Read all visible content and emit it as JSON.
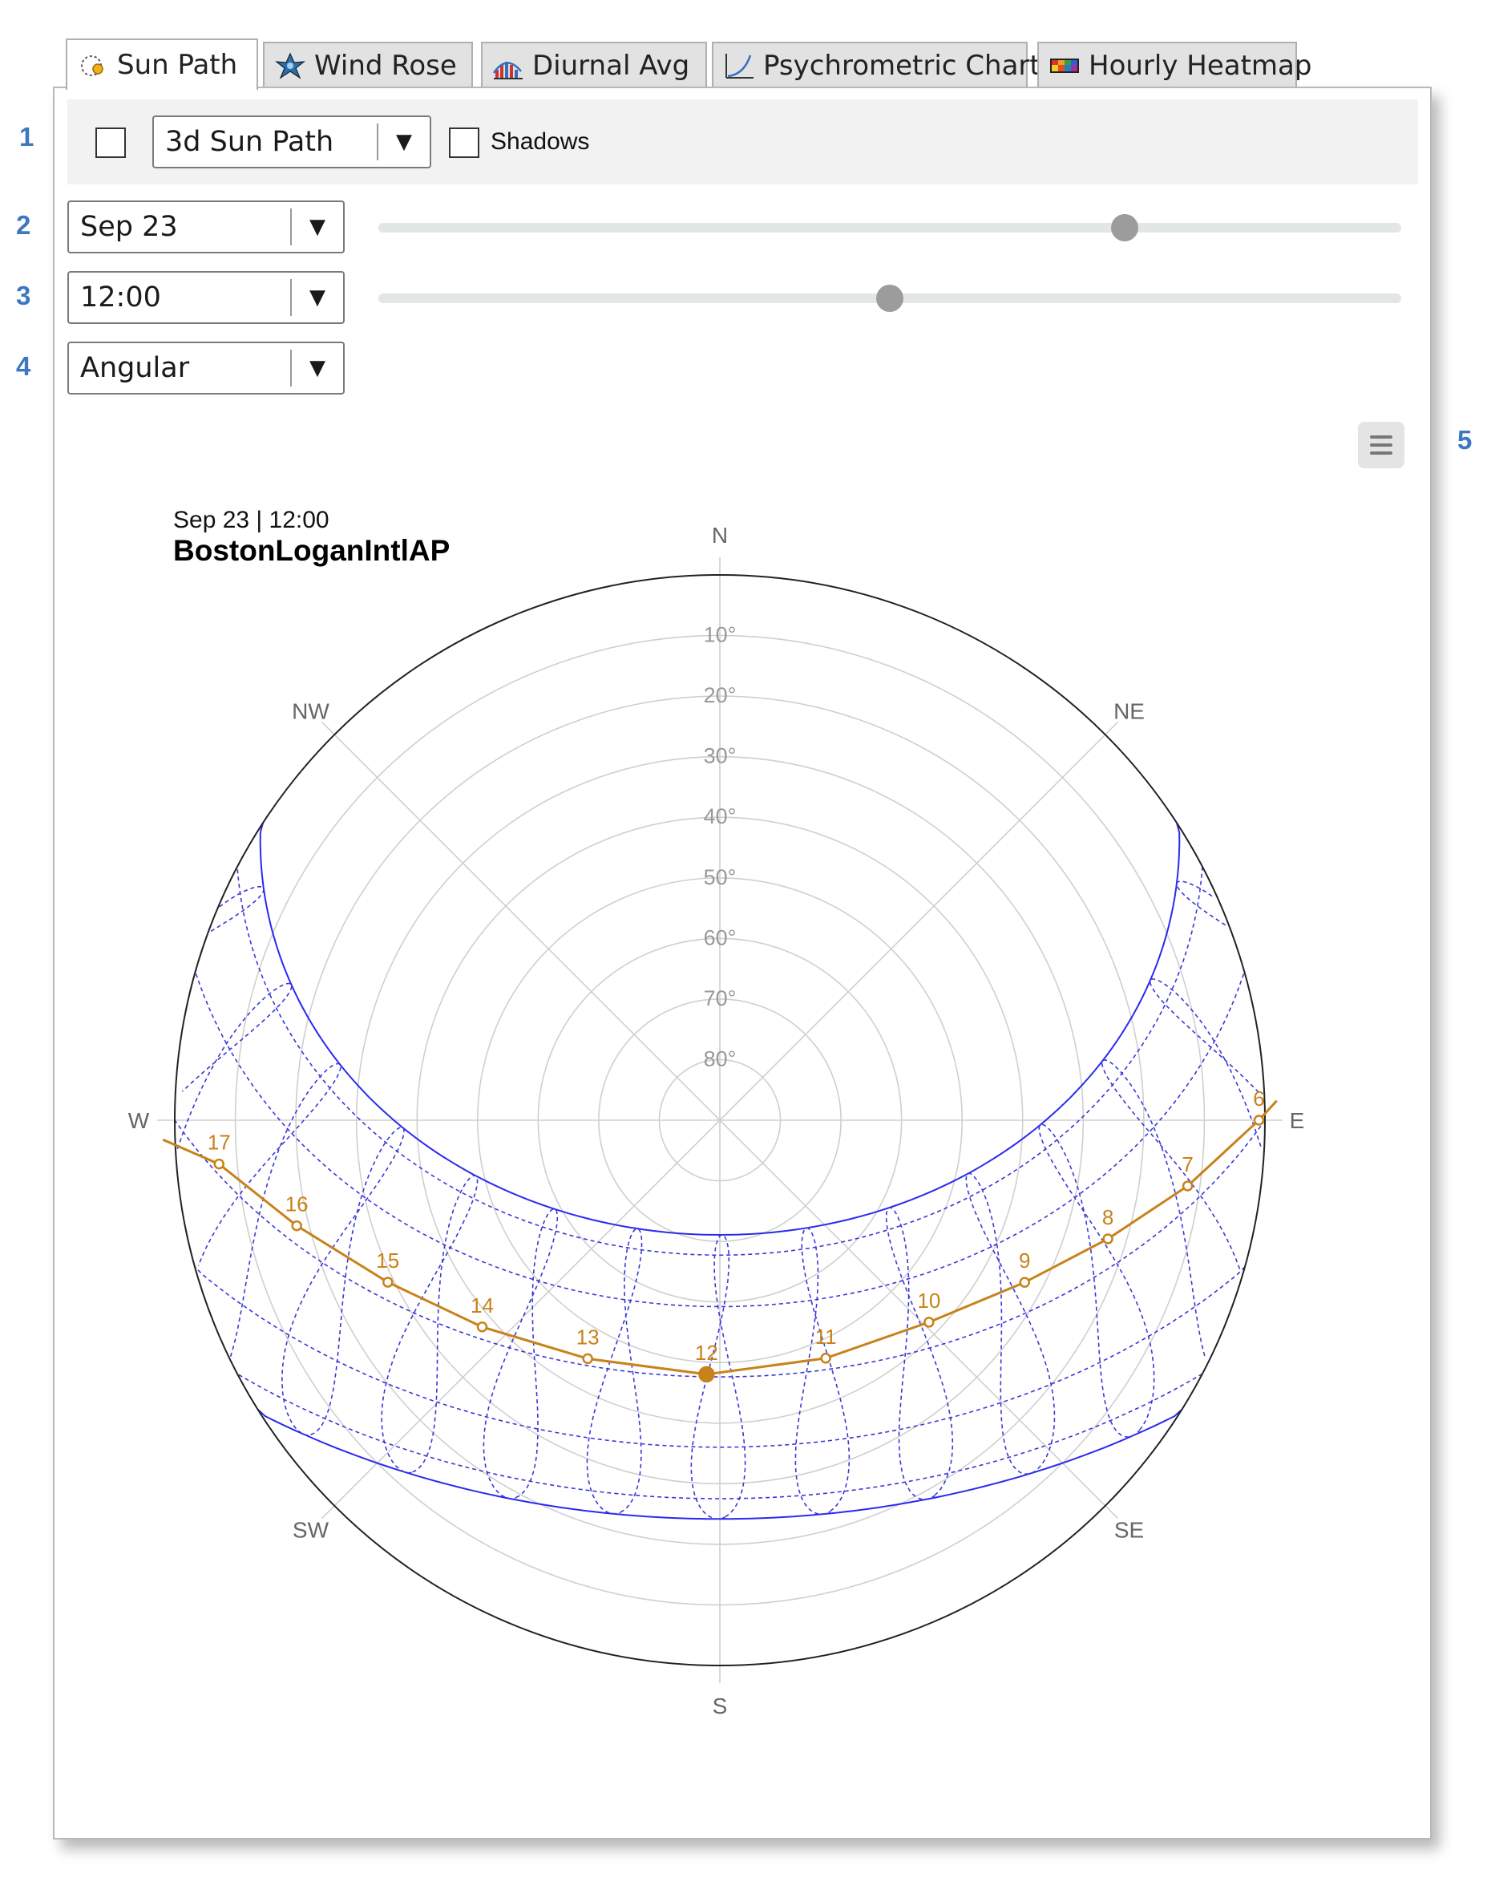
{
  "callouts": [
    "1",
    "2",
    "3",
    "4",
    "5"
  ],
  "tabs": [
    {
      "label": "Sun Path",
      "icon": "sun-path-icon",
      "active": true
    },
    {
      "label": "Wind Rose",
      "icon": "wind-rose-icon",
      "active": false
    },
    {
      "label": "Diurnal Avg",
      "icon": "diurnal-avg-icon",
      "active": false
    },
    {
      "label": "Psychrometric Chart",
      "icon": "psychrometric-icon",
      "active": false
    },
    {
      "label": "Hourly Heatmap",
      "icon": "heatmap-icon",
      "active": false
    }
  ],
  "toolbar": {
    "mode_checkbox_checked": false,
    "view_select": "3d Sun Path",
    "shadows_label": "Shadows",
    "shadows_checked": false
  },
  "controls": {
    "date_select": "Sep 23",
    "date_slider_fraction": 0.73,
    "time_select": "12:00",
    "time_slider_fraction": 0.5,
    "projection_select": "Angular"
  },
  "chart_header": {
    "subtitle": "Sep 23 | 12:00",
    "title": "BostonLoganIntlAP"
  },
  "chart_data": {
    "type": "polar-sun-path",
    "projection": "Angular",
    "compass": [
      "N",
      "NE",
      "E",
      "SE",
      "S",
      "SW",
      "W",
      "NW"
    ],
    "altitude_rings": [
      "10°",
      "20°",
      "30°",
      "40°",
      "50°",
      "60°",
      "70°",
      "80°"
    ],
    "selected_day": "Sep 23",
    "selected_hour": 12,
    "sun_points": [
      {
        "hour": 6,
        "azimuth": 90,
        "altitude": 1
      },
      {
        "hour": 7,
        "azimuth": 98,
        "altitude": 12
      },
      {
        "hour": 8,
        "azimuth": 107,
        "altitude": 23
      },
      {
        "hour": 9,
        "azimuth": 118,
        "altitude": 33
      },
      {
        "hour": 10,
        "azimuth": 134,
        "altitude": 42
      },
      {
        "hour": 11,
        "azimuth": 156,
        "altitude": 47
      },
      {
        "hour": 12,
        "azimuth": 183,
        "altitude": 48
      },
      {
        "hour": 13,
        "azimuth": 209,
        "altitude": 45
      },
      {
        "hour": 14,
        "azimuth": 229,
        "altitude": 38
      },
      {
        "hour": 15,
        "azimuth": 244,
        "altitude": 29
      },
      {
        "hour": 16,
        "azimuth": 256,
        "altitude": 18
      },
      {
        "hour": 17,
        "azimuth": 265,
        "altitude": 7
      }
    ],
    "colors": {
      "selected_path": "#c8821a",
      "solstice_paths": "#2a2af0",
      "analemmas": "#3838d8",
      "grid": "#cfcfcf",
      "outline": "#222222"
    }
  }
}
